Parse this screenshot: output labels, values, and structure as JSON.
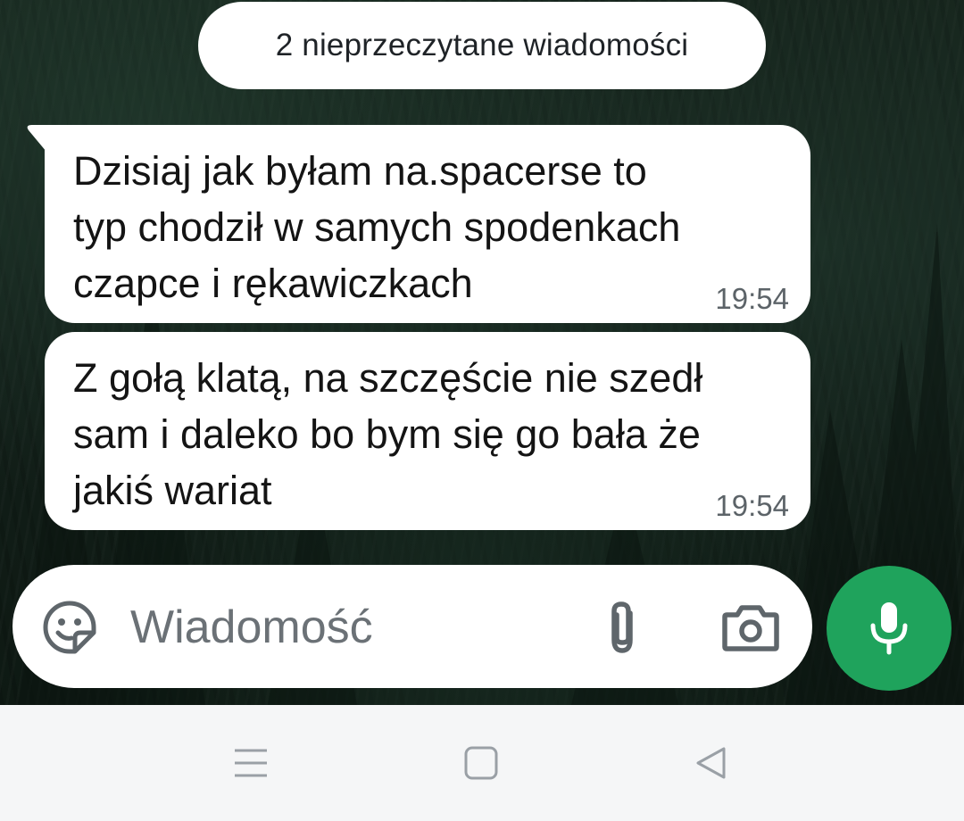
{
  "unread_banner": {
    "label": "2 nieprzeczytane wiadomości"
  },
  "messages": [
    {
      "text": "Dzisiaj jak byłam na.spacerse to\ntyp chodził w samych spodenkach\nczapce i rękawiczkach",
      "time": "19:54"
    },
    {
      "text": "Z gołą klatą, na szczęście nie szedł\nsam i daleko bo bym się go bała że\njakiś wariat",
      "time": "19:54"
    }
  ],
  "composer": {
    "placeholder": "Wiadomość",
    "icons": [
      "emoji-sticker-icon",
      "paperclip-icon",
      "camera-icon"
    ]
  },
  "mic_button": {
    "icon": "microphone-icon",
    "color": "#1fa35c"
  },
  "navbar": {
    "icons": [
      "menu-lines-icon",
      "home-square-icon",
      "back-triangle-icon"
    ]
  },
  "colors": {
    "bubble": "#ffffff",
    "accent_green": "#1fa35c",
    "navbar_bg": "#f5f6f7"
  }
}
